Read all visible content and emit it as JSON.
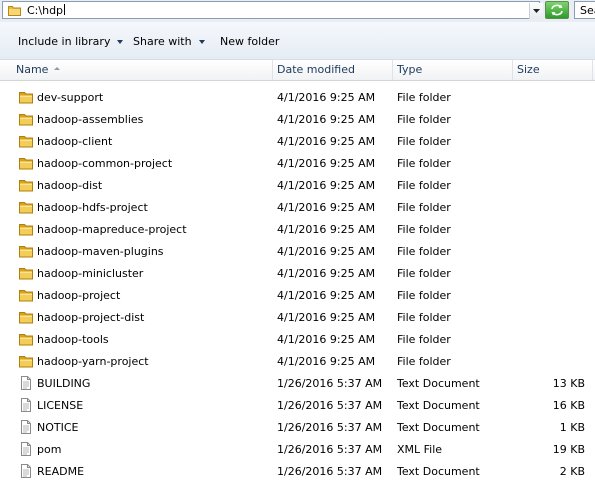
{
  "address_bar": {
    "path": "C:\\hdp",
    "search_placeholder": "Sea"
  },
  "command_bar": {
    "include_in_library": "Include in library",
    "share_with": "Share with",
    "new_folder": "New folder"
  },
  "columns": {
    "name": "Name",
    "date_modified": "Date modified",
    "type": "Type",
    "size": "Size"
  },
  "files": [
    {
      "name": "dev-support",
      "date": "4/1/2016 9:25 AM",
      "type": "File folder",
      "size": "",
      "icon": "folder-icon"
    },
    {
      "name": "hadoop-assemblies",
      "date": "4/1/2016 9:25 AM",
      "type": "File folder",
      "size": "",
      "icon": "folder-icon"
    },
    {
      "name": "hadoop-client",
      "date": "4/1/2016 9:25 AM",
      "type": "File folder",
      "size": "",
      "icon": "folder-icon"
    },
    {
      "name": "hadoop-common-project",
      "date": "4/1/2016 9:25 AM",
      "type": "File folder",
      "size": "",
      "icon": "folder-icon"
    },
    {
      "name": "hadoop-dist",
      "date": "4/1/2016 9:25 AM",
      "type": "File folder",
      "size": "",
      "icon": "folder-icon"
    },
    {
      "name": "hadoop-hdfs-project",
      "date": "4/1/2016 9:25 AM",
      "type": "File folder",
      "size": "",
      "icon": "folder-icon"
    },
    {
      "name": "hadoop-mapreduce-project",
      "date": "4/1/2016 9:25 AM",
      "type": "File folder",
      "size": "",
      "icon": "folder-icon"
    },
    {
      "name": "hadoop-maven-plugins",
      "date": "4/1/2016 9:25 AM",
      "type": "File folder",
      "size": "",
      "icon": "folder-icon"
    },
    {
      "name": "hadoop-minicluster",
      "date": "4/1/2016 9:25 AM",
      "type": "File folder",
      "size": "",
      "icon": "folder-icon"
    },
    {
      "name": "hadoop-project",
      "date": "4/1/2016 9:25 AM",
      "type": "File folder",
      "size": "",
      "icon": "folder-icon"
    },
    {
      "name": "hadoop-project-dist",
      "date": "4/1/2016 9:25 AM",
      "type": "File folder",
      "size": "",
      "icon": "folder-icon"
    },
    {
      "name": "hadoop-tools",
      "date": "4/1/2016 9:25 AM",
      "type": "File folder",
      "size": "",
      "icon": "folder-icon"
    },
    {
      "name": "hadoop-yarn-project",
      "date": "4/1/2016 9:25 AM",
      "type": "File folder",
      "size": "",
      "icon": "folder-icon"
    },
    {
      "name": "BUILDING",
      "date": "1/26/2016 5:37 AM",
      "type": "Text Document",
      "size": "13 KB",
      "icon": "text-file-icon"
    },
    {
      "name": "LICENSE",
      "date": "1/26/2016 5:37 AM",
      "type": "Text Document",
      "size": "16 KB",
      "icon": "text-file-icon"
    },
    {
      "name": "NOTICE",
      "date": "1/26/2016 5:37 AM",
      "type": "Text Document",
      "size": "1 KB",
      "icon": "text-file-icon"
    },
    {
      "name": "pom",
      "date": "1/26/2016 5:37 AM",
      "type": "XML File",
      "size": "19 KB",
      "icon": "xml-file-icon"
    },
    {
      "name": "README",
      "date": "1/26/2016 5:37 AM",
      "type": "Text Document",
      "size": "2 KB",
      "icon": "text-file-icon"
    }
  ],
  "colors": {
    "header_text": "#1e395b",
    "folder": "#e8b945",
    "refresh_green": "#2f9a2b"
  }
}
